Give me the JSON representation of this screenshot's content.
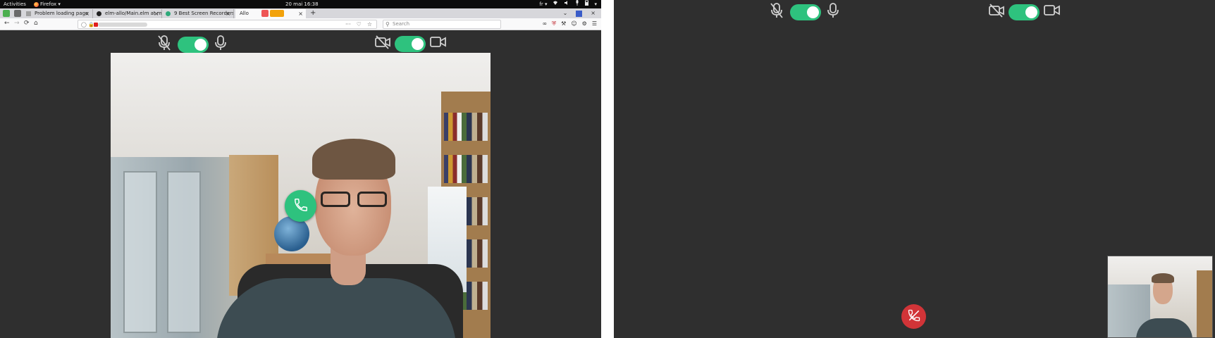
{
  "top_bar": {
    "activities_label": "Activities",
    "app_menu_label": "Firefox ▾",
    "clock": "20 mai  16:38",
    "keyboard_layout": "fr ▾",
    "system_menu_arrow": "▾"
  },
  "browser": {
    "tabs": [
      {
        "label": "Problem loading page",
        "icon": "warning-icon"
      },
      {
        "label": "elm-allo/Main.elm at m",
        "icon": "github-icon"
      },
      {
        "label": "9 Best Screen Recorders",
        "icon": "site-icon"
      },
      {
        "label": "Allo",
        "icon": "site-icon"
      }
    ],
    "new_tab_label": "+",
    "tab_overflow_label": "⌄",
    "close_window_label": "×",
    "close_tab_label": "×",
    "search_placeholder": "Search",
    "page_actions_label": "···",
    "nav": {
      "back": "←",
      "forward": "→",
      "reload": "⟳",
      "home": "⌂"
    }
  },
  "call": {
    "mic_toggle_on": true,
    "camera_toggle_on": true,
    "remote_call_state": "incoming",
    "local_call_state": "in-call"
  },
  "colors": {
    "accent_green": "#2ec27e",
    "hangup_red": "#d13438",
    "background": "#2f2f2f"
  },
  "icons": {
    "mic_off": "microphone-off-icon",
    "mic_on": "microphone-icon",
    "cam_off": "camera-off-icon",
    "cam_on": "camera-icon",
    "call": "phone-icon",
    "hangup": "phone-hangup-icon"
  }
}
